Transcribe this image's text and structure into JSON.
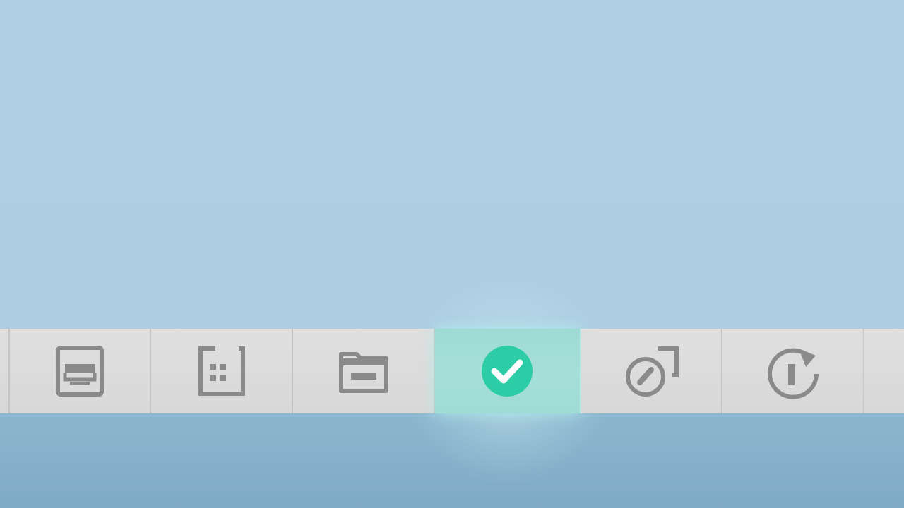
{
  "dock": {
    "items": [
      {
        "icon": "document-icon",
        "selected": false
      },
      {
        "icon": "calendar-icon",
        "selected": false
      },
      {
        "icon": "folder-icon",
        "selected": false
      },
      {
        "icon": "checkmark-circle-icon",
        "selected": true
      },
      {
        "icon": "external-edit-icon",
        "selected": false
      },
      {
        "icon": "refresh-icon",
        "selected": false
      }
    ]
  },
  "colors": {
    "background": "#aecde3",
    "lower_band": "#84afca",
    "dock": "#dcdcdc",
    "icon_gray": "#8a8a8a",
    "selected_slot": "#a2dcd7",
    "accent_green": "#2bcca6"
  }
}
